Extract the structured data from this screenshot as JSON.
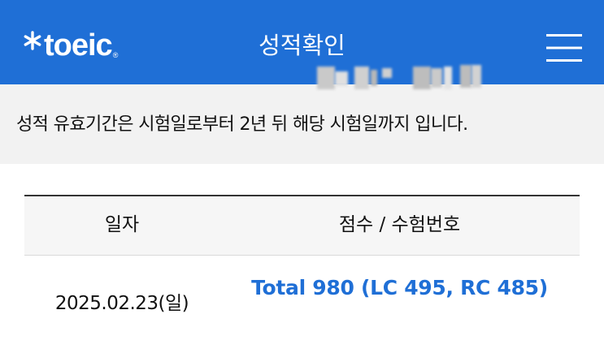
{
  "header": {
    "logo_text": "toeic",
    "logo_reg": "®",
    "title": "성적확인",
    "logo_icon": "asterisk-icon",
    "menu_icon": "hamburger-menu-icon"
  },
  "notice": {
    "text": "성적 유효기간은 시험일로부터 2년 뒤 해당 시험일까지 입니다."
  },
  "table": {
    "columns": [
      "일자",
      "점수 / 수험번호"
    ],
    "rows": [
      {
        "date": "2025.02.23(일)",
        "score": "Total 980 (LC 495, RC 485)"
      }
    ]
  },
  "colors": {
    "brand": "#1f6fd6",
    "notice_bg": "#f2f2f2",
    "text": "#111111"
  }
}
